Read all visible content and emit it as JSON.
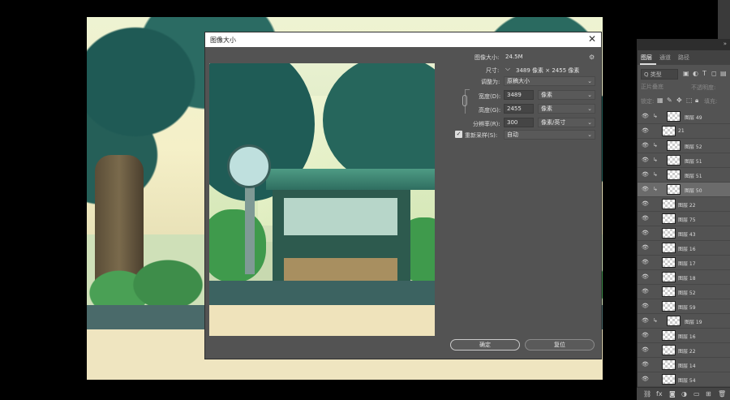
{
  "dialog": {
    "title": "图像大小",
    "close_glyph": "✕",
    "image_size_label": "图像大小:",
    "image_size_value": "24.5M",
    "dimensions_label": "尺寸:",
    "dimensions_value": "3489 像素 × 2455 像素",
    "fit_to_label": "调整为:",
    "fit_to_value": "原稿大小",
    "width_label": "宽度(D):",
    "width_value": "3489",
    "width_unit": "像素",
    "height_label": "高度(G):",
    "height_value": "2455",
    "height_unit": "像素",
    "resolution_label": "分辨率(R):",
    "resolution_value": "300",
    "resolution_unit": "像素/英寸",
    "resample_label": "重新采样(S):",
    "resample_checked": true,
    "resample_value": "自动",
    "ok_label": "确定",
    "reset_label": "复位"
  },
  "layers_panel": {
    "tabs": [
      {
        "label": "图层",
        "active": true
      },
      {
        "label": "通道",
        "active": false
      },
      {
        "label": "路径",
        "active": false
      }
    ],
    "filter_placeholder": "Q 类型",
    "blend_mode": "正片叠底",
    "opacity_label": "不透明度:",
    "lock_label": "锁定:",
    "fill_label": "填充:",
    "layers": [
      {
        "name": "图层 49",
        "clip": true,
        "indent": true,
        "selected": false
      },
      {
        "name": "21",
        "clip": false,
        "indent": false,
        "selected": false
      },
      {
        "name": "图层 52",
        "clip": true,
        "indent": true,
        "selected": false
      },
      {
        "name": "图层 51",
        "clip": true,
        "indent": true,
        "selected": false
      },
      {
        "name": "图层 51",
        "clip": true,
        "indent": true,
        "selected": false
      },
      {
        "name": "图层 50",
        "clip": true,
        "indent": true,
        "selected": true
      },
      {
        "name": "图层 22",
        "clip": false,
        "indent": false,
        "selected": false
      },
      {
        "name": "图层 75",
        "clip": false,
        "indent": false,
        "selected": false
      },
      {
        "name": "图层 43",
        "clip": false,
        "indent": false,
        "selected": false
      },
      {
        "name": "图层 16",
        "clip": false,
        "indent": false,
        "selected": false
      },
      {
        "name": "图层 17",
        "clip": false,
        "indent": false,
        "selected": false
      },
      {
        "name": "图层 18",
        "clip": false,
        "indent": false,
        "selected": false
      },
      {
        "name": "图层 52",
        "clip": false,
        "indent": false,
        "selected": false
      },
      {
        "name": "图层 59",
        "clip": false,
        "indent": false,
        "selected": false
      },
      {
        "name": "图层 19",
        "clip": true,
        "indent": true,
        "selected": false
      },
      {
        "name": "图层 16",
        "clip": false,
        "indent": false,
        "selected": false
      },
      {
        "name": "图层 22",
        "clip": false,
        "indent": false,
        "selected": false
      },
      {
        "name": "图层 14",
        "clip": false,
        "indent": false,
        "selected": false
      },
      {
        "name": "图层 54",
        "clip": false,
        "indent": false,
        "selected": false
      },
      {
        "name": "图层 56",
        "clip": true,
        "indent": true,
        "selected": false
      }
    ],
    "bottom_icons": [
      "link-icon",
      "fx-icon",
      "mask-icon",
      "adjustment-icon",
      "folder-icon",
      "new-layer-icon",
      "trash-icon"
    ]
  }
}
